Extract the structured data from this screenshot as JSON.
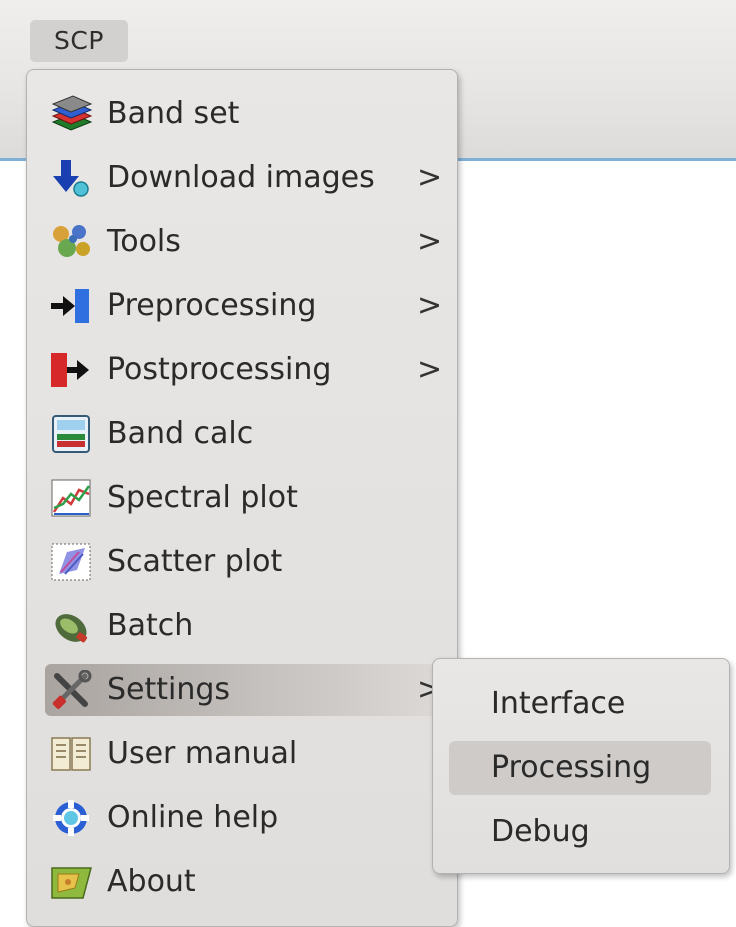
{
  "menubar": {
    "scp_label": "SCP"
  },
  "menu": {
    "items": [
      {
        "label": "Band set",
        "icon": "band-set-icon",
        "has_submenu": false
      },
      {
        "label": "Download images",
        "icon": "download-images-icon",
        "has_submenu": true
      },
      {
        "label": "Tools",
        "icon": "tools-icon",
        "has_submenu": true
      },
      {
        "label": "Preprocessing",
        "icon": "preprocessing-icon",
        "has_submenu": true
      },
      {
        "label": "Postprocessing",
        "icon": "postprocessing-icon",
        "has_submenu": true
      },
      {
        "label": "Band calc",
        "icon": "band-calc-icon",
        "has_submenu": false
      },
      {
        "label": "Spectral plot",
        "icon": "spectral-plot-icon",
        "has_submenu": false
      },
      {
        "label": "Scatter plot",
        "icon": "scatter-plot-icon",
        "has_submenu": false
      },
      {
        "label": "Batch",
        "icon": "batch-icon",
        "has_submenu": false
      },
      {
        "label": "Settings",
        "icon": "settings-icon",
        "has_submenu": true,
        "active": true
      },
      {
        "label": "User manual",
        "icon": "user-manual-icon",
        "has_submenu": false
      },
      {
        "label": "Online help",
        "icon": "online-help-icon",
        "has_submenu": false
      },
      {
        "label": "About",
        "icon": "about-icon",
        "has_submenu": false
      }
    ],
    "submenu_arrow": ">"
  },
  "settings_submenu": {
    "items": [
      {
        "label": "Interface"
      },
      {
        "label": "Processing",
        "hovered": true
      },
      {
        "label": "Debug"
      }
    ]
  },
  "colors": {
    "accent_line": "#7fb1d8",
    "menu_background": "#e4e2e0",
    "active_item": "#b6b1ad",
    "hover_item": "#cfcbc8"
  }
}
